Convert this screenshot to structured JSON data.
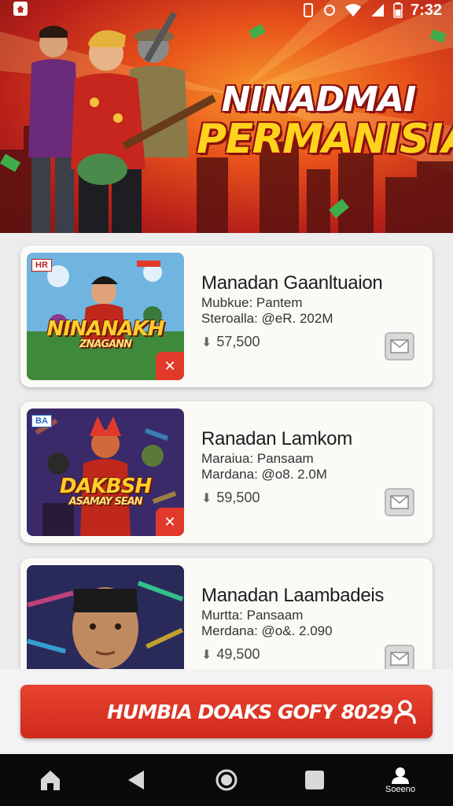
{
  "status_bar": {
    "time": "7:32",
    "icons": [
      "home-badge-icon",
      "vibrate-icon",
      "sync-icon",
      "wifi-icon",
      "signal-icon",
      "battery-icon"
    ]
  },
  "hero": {
    "title_line1": "NINADMAI",
    "title_line2": "PERMANISIA"
  },
  "cards": [
    {
      "thumb_tag": "HR",
      "thumb_logo": "NINANAKH",
      "thumb_logo_sub": "ZNAGANN",
      "title": "Manadan Gaanltuaion",
      "line1": "Mubkue: Pantem",
      "line2": "Steroalla: @eR. 202M",
      "count": "57,500"
    },
    {
      "thumb_tag": "BA",
      "thumb_logo": "DAKBSH",
      "thumb_logo_sub": "ASAMAY SEAN",
      "title": "Ranadan Lamkom",
      "line1": "Maraiua: Pansaam",
      "line2": "Mardana: @o8. 2.0M",
      "count": "59,500"
    },
    {
      "thumb_tag": "",
      "thumb_logo": "",
      "thumb_logo_sub": "",
      "title": "Manadan Laambadeis",
      "line1": "Murtta: Pansaam",
      "line2": "Merdana: @o&. 2.090",
      "count": "49,500"
    }
  ],
  "cta": {
    "label": "HUMBIA DOAKS GOFY 8029"
  },
  "nav": {
    "profile_label": "Soeeno"
  },
  "colors": {
    "accent": "#d9301f",
    "hero_yellow": "#ffd21c",
    "card_bg": "#fbfaf7"
  }
}
